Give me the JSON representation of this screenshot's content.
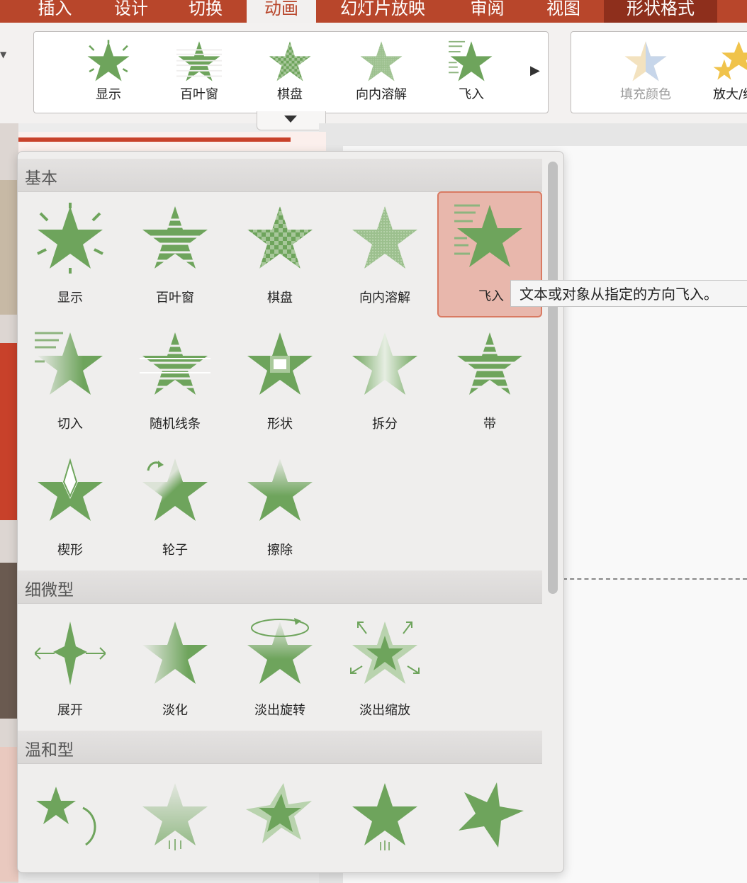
{
  "tabs": [
    "插入",
    "设计",
    "切换",
    "动画",
    "幻灯片放映",
    "审阅",
    "视图",
    "形状格式"
  ],
  "ribbon_gallery": [
    "显示",
    "百叶窗",
    "棋盘",
    "向内溶解",
    "飞入"
  ],
  "ribbon_right": [
    "填充颜色",
    "放大/缩"
  ],
  "sections": [
    "基本",
    "细微型",
    "温和型"
  ],
  "basic": [
    "显示",
    "百叶窗",
    "棋盘",
    "向内溶解",
    "飞入",
    "切入",
    "随机线条",
    "形状",
    "拆分",
    "带",
    "楔形",
    "轮子",
    "擦除"
  ],
  "subtle": [
    "展开",
    "淡化",
    "淡出旋转",
    "淡出缩放"
  ],
  "tooltip": "文本或对象从指定的方向飞入。",
  "colors": {
    "accent": "#b8462b",
    "star": "#6ea45c",
    "selected": "#e8b7ac"
  }
}
